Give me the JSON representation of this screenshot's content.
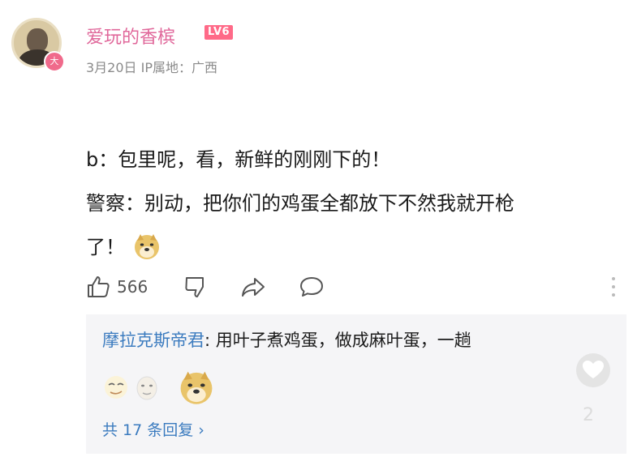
{
  "comment": {
    "username": "爱玩的香槟",
    "level_badge": "LV6",
    "avatar_badge": "大",
    "meta": "3月20日 IP属地：广西",
    "lines": [
      "b：包里呢，看，新鲜的刚刚下的！",
      "警察：别动，把你们的鸡蛋全都放下不然我就开枪",
      "了！"
    ],
    "like_count": "566"
  },
  "reply": {
    "author": "摩拉克斯帝君",
    "text": ": 用叶子煮鸡蛋，做成麻叶蛋，一趟",
    "more_label": "共 17 条回复 ›",
    "fab_count": "2"
  },
  "colors": {
    "username": "#e0679a",
    "level_badge": "#ff6a88",
    "link_blue": "#3b7bbf",
    "reply_bg": "#f5f5f7"
  },
  "icons": [
    "thumbs-up-icon",
    "thumbs-down-icon",
    "share-icon",
    "comment-icon",
    "more-vertical-icon",
    "doge-emoji-icon",
    "heart-icon"
  ]
}
